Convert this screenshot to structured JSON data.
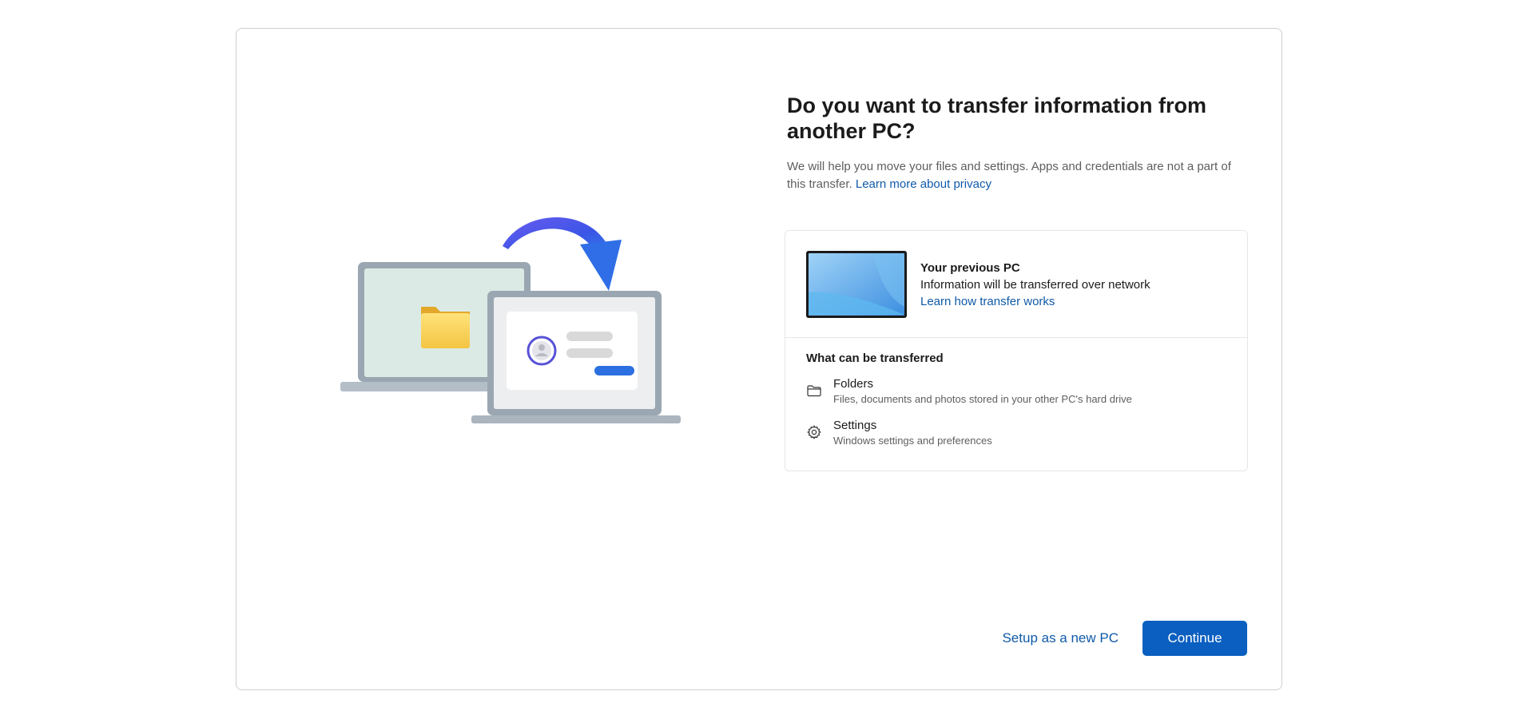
{
  "page": {
    "title": "Do you want to transfer information from another PC?",
    "description": "We will help you move your files and settings. Apps and credentials are not a part of this transfer.",
    "privacy_link": "Learn more about privacy"
  },
  "previous_pc": {
    "title": "Your previous PC",
    "subtitle": "Information will be transferred over network",
    "link": "Learn how transfer works"
  },
  "transferable": {
    "title": "What can be transferred",
    "items": [
      {
        "name": "Folders",
        "description": "Files, documents and photos stored in your other PC's hard drive",
        "icon": "folder-icon"
      },
      {
        "name": "Settings",
        "description": "Windows settings and preferences",
        "icon": "gear-icon"
      }
    ]
  },
  "footer": {
    "secondary_label": "Setup as a new PC",
    "primary_label": "Continue"
  },
  "colors": {
    "accent": "#0a5fc0",
    "link": "#0f5aa8",
    "border": "#cfcfcf"
  }
}
